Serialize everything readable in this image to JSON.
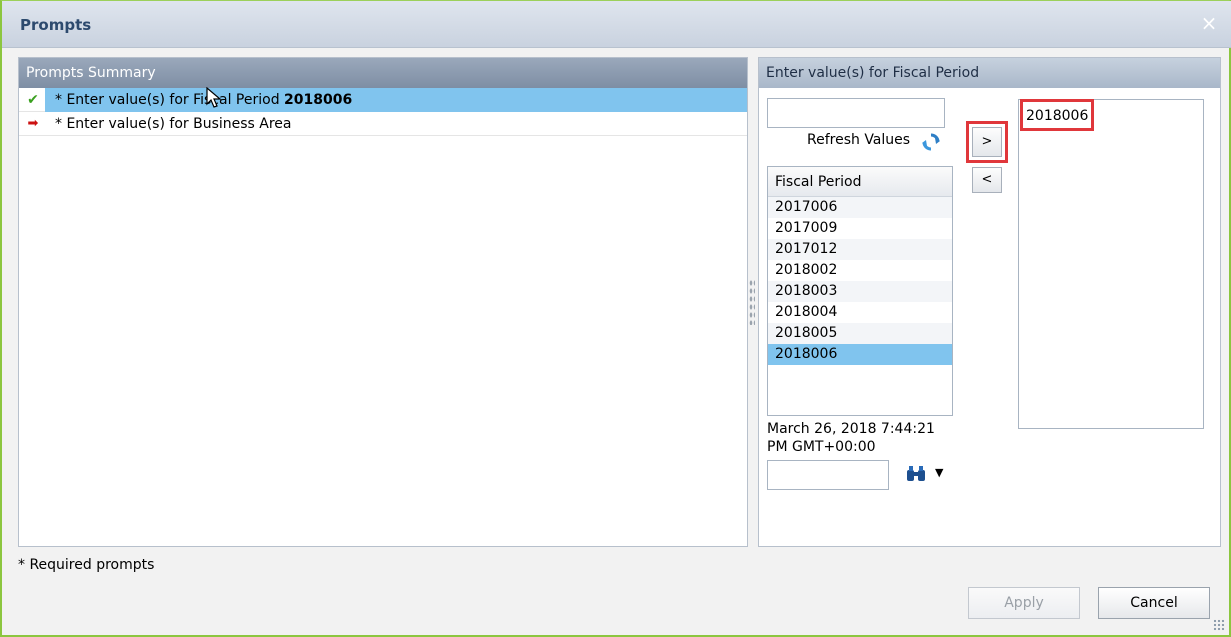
{
  "window": {
    "title": "Prompts",
    "close_glyph": "×"
  },
  "summary": {
    "header": "Prompts Summary",
    "rows": [
      {
        "status": "check-icon",
        "label": "* Enter value(s) for Fiscal Period",
        "value": "2018006",
        "selected": true
      },
      {
        "status": "red-arrow-icon",
        "label": "* Enter value(s) for Business Area",
        "value": "",
        "selected": false
      }
    ]
  },
  "prompt": {
    "header": "Enter value(s) for Fiscal Period",
    "search_value": "",
    "refresh_label": "Refresh Values",
    "list_header": "Fiscal Period",
    "values": [
      "2017006",
      "2017009",
      "2017012",
      "2018002",
      "2018003",
      "2018004",
      "2018005",
      "2018006"
    ],
    "selected_in_list": "2018006",
    "add_button": ">",
    "remove_button": "<",
    "selected_values": [
      "2018006"
    ],
    "timestamp_line1": "March 26, 2018 7:44:21",
    "timestamp_line2": "PM GMT+00:00",
    "filter_value": ""
  },
  "footer": {
    "required_note": "* Required prompts",
    "apply_label": "Apply",
    "cancel_label": "Cancel"
  },
  "colors": {
    "accent_border": "#8cc63f",
    "selection": "#80c4ee",
    "highlight": "#e0373b"
  }
}
